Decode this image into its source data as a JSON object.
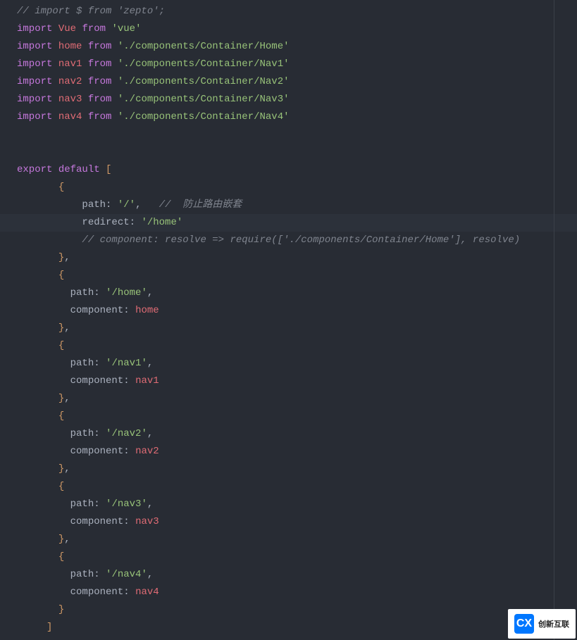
{
  "lines": {
    "l1_comment": "// import $ from 'zepto';",
    "l2_import": "import",
    "l2_name": "Vue",
    "l2_from": "from",
    "l2_str": "'vue'",
    "l3_import": "import",
    "l3_name": "home",
    "l3_from": "from",
    "l3_str": "'./components/Container/Home'",
    "l4_import": "import",
    "l4_name": "nav1",
    "l4_from": "from",
    "l4_str": "'./components/Container/Nav1'",
    "l5_import": "import",
    "l5_name": "nav2",
    "l5_from": "from",
    "l5_str": "'./components/Container/Nav2'",
    "l6_import": "import",
    "l6_name": "nav3",
    "l6_from": "from",
    "l6_str": "'./components/Container/Nav3'",
    "l7_import": "import",
    "l7_name": "nav4",
    "l7_from": "from",
    "l7_str": "'./components/Container/Nav4'",
    "l10_export": "export",
    "l10_default": "default",
    "l10_bracket": "[",
    "l11_brace": "{",
    "l12_path": "path",
    "l12_colon": ":",
    "l12_val": "'/'",
    "l12_comma": ",",
    "l12_comment": "//  防止路由嵌套",
    "l13_prop": "redirect",
    "l13_colon": ":",
    "l13_val": "'/home'",
    "l14_comment": "// component: resolve => require(['./components/Container/Home'], resolve)",
    "l15_close": "}",
    "l15_comma": ",",
    "l16_brace": "{",
    "l17_path": "path",
    "l17_colon": ":",
    "l17_val": "'/home'",
    "l17_comma": ",",
    "l18_prop": "component",
    "l18_colon": ":",
    "l18_val": "home",
    "l19_close": "}",
    "l19_comma": ",",
    "l20_brace": "{",
    "l21_path": "path",
    "l21_colon": ":",
    "l21_val": "'/nav1'",
    "l21_comma": ",",
    "l22_prop": "component",
    "l22_colon": ":",
    "l22_val": "nav1",
    "l23_close": "}",
    "l23_comma": ",",
    "l24_brace": "{",
    "l25_path": "path",
    "l25_colon": ":",
    "l25_val": "'/nav2'",
    "l25_comma": ",",
    "l26_prop": "component",
    "l26_colon": ":",
    "l26_val": "nav2",
    "l27_close": "}",
    "l27_comma": ",",
    "l28_brace": "{",
    "l29_path": "path",
    "l29_colon": ":",
    "l29_val": "'/nav3'",
    "l29_comma": ",",
    "l30_prop": "component",
    "l30_colon": ":",
    "l30_val": "nav3",
    "l31_close": "}",
    "l31_comma": ",",
    "l32_brace": "{",
    "l33_path": "path",
    "l33_colon": ":",
    "l33_val": "'/nav4'",
    "l33_comma": ",",
    "l34_prop": "component",
    "l34_colon": ":",
    "l34_val": "nav4",
    "l35_close": "}",
    "l36_bracket": "]"
  },
  "watermark": {
    "logo": "CX",
    "text": "创新互联"
  }
}
